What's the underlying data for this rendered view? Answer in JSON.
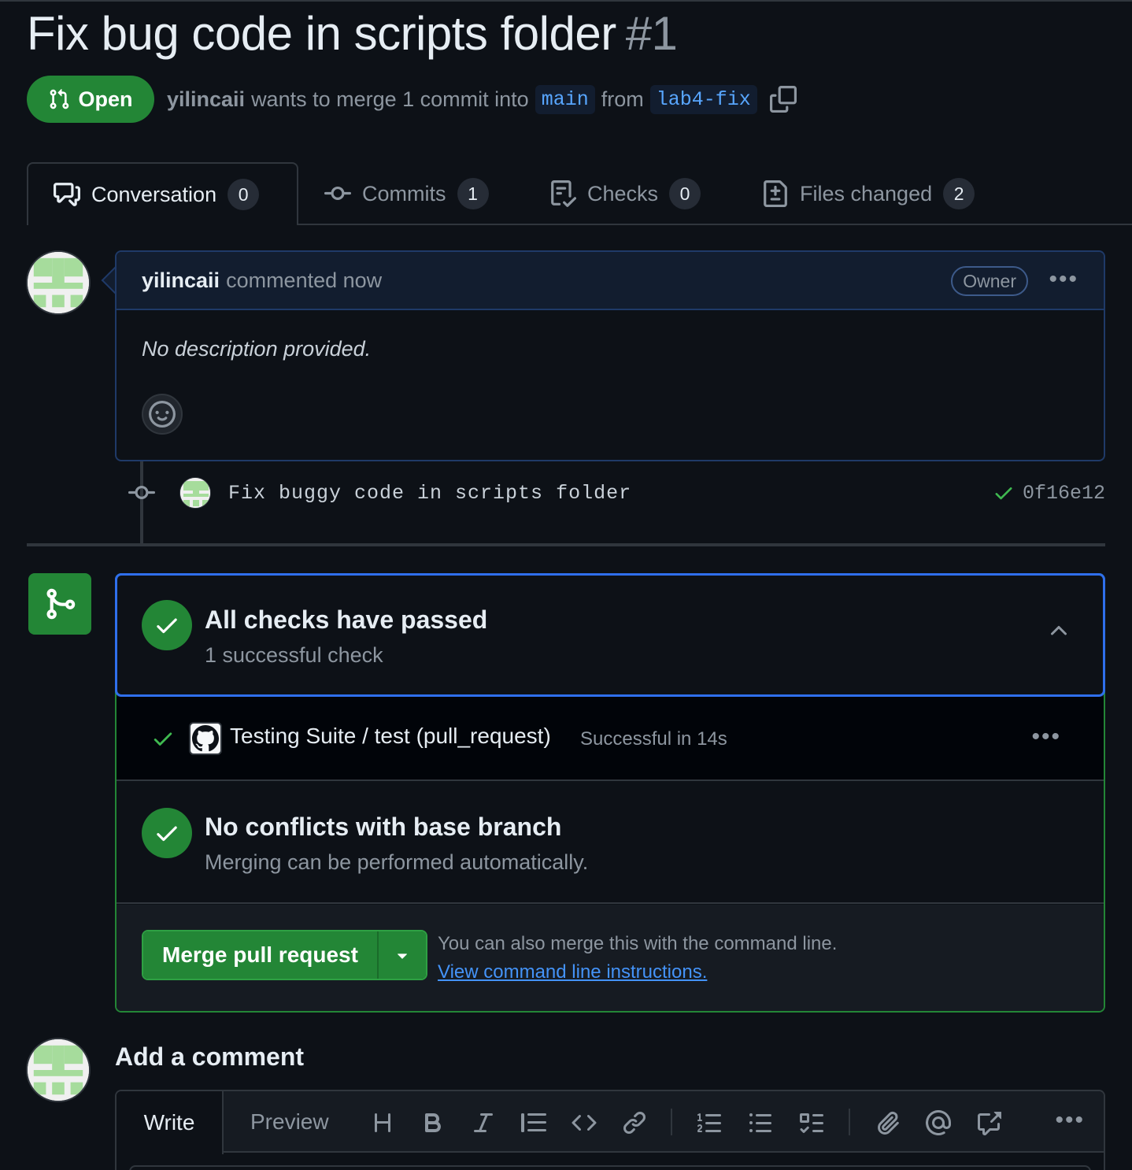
{
  "pr": {
    "title": "Fix bug code in scripts folder",
    "number": "#1",
    "state": "Open",
    "author": "yilincaii",
    "merge_text_1": "wants to merge 1 commit into",
    "base_branch": "main",
    "merge_text_2": "from",
    "head_branch": "lab4-fix"
  },
  "tabs": [
    {
      "label": "Conversation",
      "count": "0",
      "icon": "comment-discussion-icon"
    },
    {
      "label": "Commits",
      "count": "1",
      "icon": "git-commit-icon"
    },
    {
      "label": "Checks",
      "count": "0",
      "icon": "checklist-icon"
    },
    {
      "label": "Files changed",
      "count": "2",
      "icon": "file-diff-icon"
    }
  ],
  "comment": {
    "author": "yilincaii",
    "action": "commented now",
    "badge": "Owner",
    "body": "No description provided."
  },
  "commit": {
    "message": "Fix buggy code in scripts folder",
    "sha": "0f16e12"
  },
  "checks": {
    "title": "All checks have passed",
    "subtitle": "1 successful check",
    "items": [
      {
        "name": "Testing Suite / test (pull_request)",
        "status": "Successful in 14s"
      }
    ]
  },
  "conflicts": {
    "title": "No conflicts with base branch",
    "subtitle": "Merging can be performed automatically."
  },
  "merge": {
    "button_label": "Merge pull request",
    "hint": "You can also merge this with the command line.",
    "link": "View command line instructions."
  },
  "add_comment": {
    "title": "Add a comment",
    "tab_write": "Write",
    "tab_preview": "Preview",
    "toolbar": [
      "heading",
      "bold",
      "italic",
      "quote",
      "code",
      "link",
      "numbered-list",
      "unordered-list",
      "task-list",
      "attach",
      "mention",
      "reference",
      "more"
    ]
  },
  "colors": {
    "background": "#0d1117",
    "success": "#238636",
    "accent_link": "#4493f8",
    "focus_border": "#2f6fec"
  }
}
